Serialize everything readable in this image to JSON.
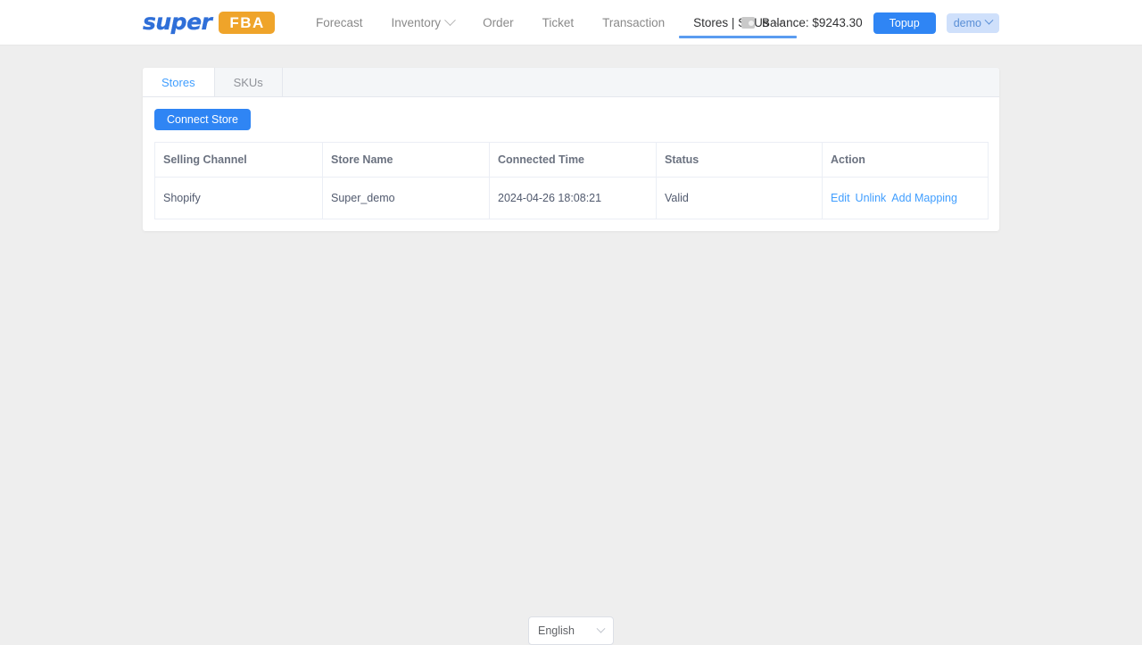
{
  "header": {
    "logo": {
      "word_primary": "super",
      "word_badge": "FBA"
    },
    "nav": [
      {
        "label": "Forecast",
        "has_chevron": false,
        "active": false
      },
      {
        "label": "Inventory",
        "has_chevron": true,
        "active": false
      },
      {
        "label": "Order",
        "has_chevron": false,
        "active": false
      },
      {
        "label": "Ticket",
        "has_chevron": false,
        "active": false
      },
      {
        "label": "Transaction",
        "has_chevron": false,
        "active": false
      },
      {
        "label": "Stores | SKUs",
        "has_chevron": true,
        "active": true
      }
    ],
    "balance_label": "Balance: $9243.30",
    "topup_label": "Topup",
    "user_label": "demo"
  },
  "card": {
    "tabs": [
      {
        "label": "Stores",
        "active": true
      },
      {
        "label": "SKUs",
        "active": false
      }
    ],
    "connect_store_label": "Connect Store",
    "table": {
      "columns": [
        "Selling Channel",
        "Store Name",
        "Connected Time",
        "Status",
        "Action"
      ],
      "rows": [
        {
          "selling_channel": "Shopify",
          "store_name": "Super_demo",
          "connected_time": "2024-04-26 18:08:21",
          "status": "Valid",
          "actions": [
            "Edit",
            "Unlink",
            "Add Mapping"
          ]
        }
      ]
    }
  },
  "footer": {
    "language_value": "English"
  },
  "colors": {
    "accent_blue": "#409eff",
    "button_blue": "#2f85f4",
    "logo_blue": "#2f6fd8",
    "badge_orange": "#efa42a",
    "page_bg": "#eeeeee"
  }
}
